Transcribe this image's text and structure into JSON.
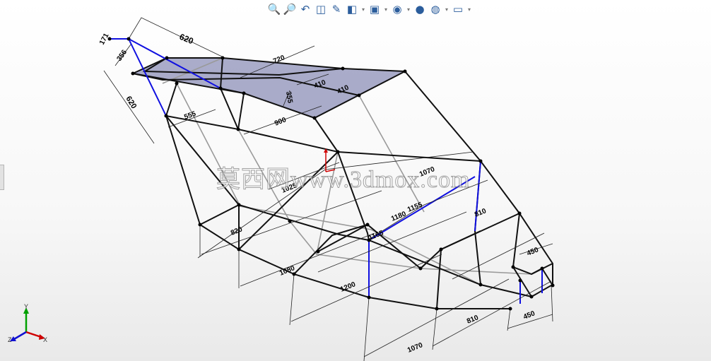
{
  "toolbar": {
    "buttons": [
      {
        "icon": "zoom-to-fit-icon",
        "glyph": "🔍"
      },
      {
        "icon": "zoom-to-area-icon",
        "glyph": "🔎"
      },
      {
        "icon": "previous-view-icon",
        "glyph": "↶"
      },
      {
        "icon": "section-view-icon",
        "glyph": "◫"
      },
      {
        "icon": "dynamic-annotation-icon",
        "glyph": "✎"
      },
      {
        "icon": "view-orientation-icon",
        "glyph": "◧",
        "dropdown": true
      },
      {
        "icon": "display-style-icon",
        "glyph": "▣",
        "dropdown": true
      },
      {
        "icon": "hide-show-items-icon",
        "glyph": "◉",
        "dropdown": true
      },
      {
        "icon": "edit-appearance-icon",
        "glyph": "●"
      },
      {
        "icon": "apply-scene-icon",
        "glyph": "◍",
        "dropdown": true
      },
      {
        "icon": "view-settings-icon",
        "glyph": "▭",
        "dropdown": true
      }
    ]
  },
  "watermark": "莫西网www.3dmox.com",
  "triad": {
    "x": "X",
    "y": "Y",
    "z": "Z"
  },
  "dimensions": [
    {
      "text": "620"
    },
    {
      "text": "171"
    },
    {
      "text": "356"
    },
    {
      "text": "620"
    },
    {
      "text": "555"
    },
    {
      "text": "720"
    },
    {
      "text": "410"
    },
    {
      "text": "410"
    },
    {
      "text": "355"
    },
    {
      "text": "900"
    },
    {
      "text": "1025"
    },
    {
      "text": "1070"
    },
    {
      "text": "820"
    },
    {
      "text": "1180"
    },
    {
      "text": "1155"
    },
    {
      "text": "1165"
    },
    {
      "text": "810"
    },
    {
      "text": "450"
    },
    {
      "text": "1080"
    },
    {
      "text": "1200"
    },
    {
      "text": "810"
    },
    {
      "text": "450"
    },
    {
      "text": "1070"
    }
  ],
  "colors": {
    "frame": "#000000",
    "selected": "#1010e0",
    "panel": "#8e90b8",
    "hidden": "#9a9a9a"
  }
}
